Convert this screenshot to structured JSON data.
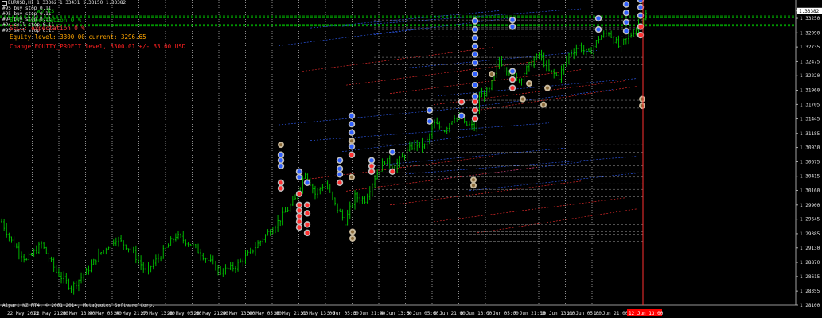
{
  "window": {
    "symbol_label": "EURUSD,H1",
    "ohlc": "1.33362 1.33431 1.33150 1.33382"
  },
  "legend_lines": [
    "#95 buy stop 0.11",
    "#95 buy stop 0.11",
    "#94 buy stop 0.11",
    "#94 sell stop 0.11",
    "#95 sell stop 0.11"
  ],
  "overlay": {
    "works": "works",
    "expectation_buy": "BUY: expectation 0 %",
    "expectation_sell": "SELL: expectation 0 %",
    "equity": "Equity level: 3300.00 current: 3296.65",
    "change": "Change EQUITY_PROFIT level, 3300.01 +/- 33.00 USD"
  },
  "copyright": "Alpari NZ MT4, © 2001-2014, MetaQuotes Software Corp.",
  "colors": {
    "background": "#000000",
    "bull": "#00c800",
    "bear": "#00c800",
    "grid": "#c8c8c8",
    "buy_line": "#3060ff",
    "sell_line": "#ff3030",
    "order_line": "#a0a0a0",
    "current_price_bg": "#ffffff",
    "period_sep": "#ff0000"
  },
  "chart_data": {
    "type": "candlestick",
    "symbol": "EURUSD",
    "timeframe": "H1",
    "ylim": [
      1.281,
      1.3355
    ],
    "y_ticks": [
      "1.33382",
      "1.33250",
      "1.32990",
      "1.32735",
      "1.32475",
      "1.32220",
      "1.31960",
      "1.31705",
      "1.31445",
      "1.31185",
      "1.30930",
      "1.30675",
      "1.30415",
      "1.30160",
      "1.29900",
      "1.29645",
      "1.29385",
      "1.29130",
      "1.28870",
      "1.28615",
      "1.28355",
      "1.28100"
    ],
    "x_ticks": [
      "22 May 2013",
      "22 May 21:00",
      "23 May 13:00",
      "24 May 05:00",
      "24 May 21:00",
      "27 May 13:00",
      "28 May 05:00",
      "28 May 21:00",
      "29 May 13:00",
      "30 May 05:00",
      "30 May 21:00",
      "31 May 13:00",
      "3 Jun 05:00",
      "3 Jun 21:00",
      "4 Jun 13:00",
      "5 Jun 05:00",
      "5 Jun 21:00",
      "6 Jun 13:00",
      "7 Jun 05:00",
      "7 Jun 21:00",
      "10 Jun 13:00",
      "11 Jun 05:00",
      "11 Jun 21:00"
    ],
    "last_tick_label": "12 Jun 13:00",
    "current_price": "1.33382",
    "horizontal_levels": [
      1.33292,
      1.33262,
      1.33137,
      1.33112
    ],
    "anchors": [
      [
        0,
        1.296
      ],
      [
        4,
        1.2925
      ],
      [
        10,
        1.289
      ],
      [
        16,
        1.292
      ],
      [
        22,
        1.287
      ],
      [
        28,
        1.2842
      ],
      [
        34,
        1.287
      ],
      [
        40,
        1.2905
      ],
      [
        46,
        1.293
      ],
      [
        52,
        1.291
      ],
      [
        58,
        1.287
      ],
      [
        64,
        1.29
      ],
      [
        70,
        1.2935
      ],
      [
        76,
        1.292
      ],
      [
        82,
        1.2895
      ],
      [
        88,
        1.287
      ],
      [
        94,
        1.288
      ],
      [
        100,
        1.2905
      ],
      [
        106,
        1.2935
      ],
      [
        112,
        1.2965
      ],
      [
        118,
        1.3
      ],
      [
        122,
        1.305
      ],
      [
        126,
        1.301
      ],
      [
        130,
        1.303
      ],
      [
        134,
        1.299
      ],
      [
        138,
        1.296
      ],
      [
        142,
        1.3005
      ],
      [
        146,
        1.3
      ],
      [
        150,
        1.304
      ],
      [
        154,
        1.307
      ],
      [
        158,
        1.306
      ],
      [
        162,
        1.308
      ],
      [
        166,
        1.31
      ],
      [
        170,
        1.3095
      ],
      [
        174,
        1.3135
      ],
      [
        178,
        1.3125
      ],
      [
        182,
        1.315
      ],
      [
        186,
        1.3135
      ],
      [
        190,
        1.313
      ],
      [
        192,
        1.3185
      ],
      [
        196,
        1.3195
      ],
      [
        200,
        1.325
      ],
      [
        204,
        1.323
      ],
      [
        208,
        1.3215
      ],
      [
        212,
        1.324
      ],
      [
        216,
        1.326
      ],
      [
        220,
        1.323
      ],
      [
        224,
        1.322
      ],
      [
        228,
        1.326
      ],
      [
        232,
        1.3275
      ],
      [
        236,
        1.326
      ],
      [
        240,
        1.329
      ],
      [
        244,
        1.33
      ],
      [
        248,
        1.3275
      ],
      [
        252,
        1.329
      ],
      [
        256,
        1.3315
      ],
      [
        260,
        1.3338
      ]
    ],
    "buy_levels": [
      1.329,
      1.3322,
      1.3325,
      1.331,
      1.325,
      1.32,
      1.318,
      1.3148,
      1.312,
      1.31,
      1.3075,
      1.306,
      1.305,
      1.303
    ],
    "sell_levels": [
      1.323,
      1.3205,
      1.319,
      1.317,
      1.316,
      1.3035,
      1.3015,
      1.299,
      1.296,
      1.294
    ],
    "order_pairs": [
      [
        1.3322,
        1.3308
      ],
      [
        1.3305,
        1.3292
      ],
      [
        1.3255,
        1.3242
      ],
      [
        1.3178,
        1.3164
      ],
      [
        1.3098,
        1.3085
      ],
      [
        1.306,
        1.3048
      ],
      [
        1.304,
        1.3028
      ],
      [
        1.3018,
        1.3005
      ],
      [
        1.2955,
        1.2942
      ],
      [
        1.2938,
        1.2925
      ]
    ]
  }
}
